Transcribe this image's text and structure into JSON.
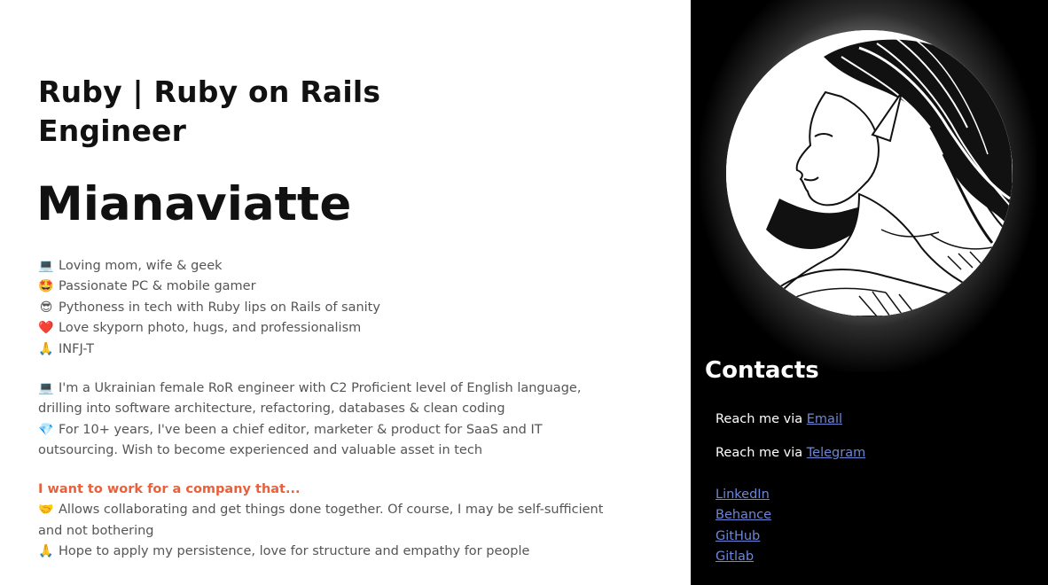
{
  "header": {
    "role": "Ruby | Ruby on Rails Engineer",
    "name": "Mianaviatte"
  },
  "bio": [
    {
      "icon": "laptop-icon",
      "glyph": "💻",
      "text": "Loving mom, wife & geek"
    },
    {
      "icon": "star-struck-icon",
      "glyph": "🤩",
      "text": "Passionate PC & mobile gamer"
    },
    {
      "icon": "sunglasses-icon",
      "glyph": "😎",
      "text": "Pythoness in tech with Ruby lips on Rails of sanity"
    },
    {
      "icon": "heart-icon",
      "glyph": "❤️",
      "text": "Love skyporn photo, hugs, and professionalism"
    },
    {
      "icon": "folded-hands-icon",
      "glyph": "🙏",
      "text": "INFJ-T"
    }
  ],
  "about": {
    "line1_glyph": "💻",
    "line1_text": "I'm a Ukrainian female RoR engineer with C2 Proficient level of English language, drilling into software architecture, refactoring, databases & clean coding",
    "line2_glyph": "💎",
    "line2_text": "For 10+ years, I've been a chief editor, marketer & product for SaaS and IT outsourcing. Wish to become experienced and valuable asset in tech"
  },
  "want": {
    "heading": "I want to work for a company that...",
    "line1_glyph": "🤝",
    "line1_text": "Allows collaborating and get things done together. Of course, I may be self-sufficient and not bothering",
    "line2_glyph": "🙏",
    "line2_text": "Hope to apply my persistence, love for structure and empathy for people"
  },
  "contacts": {
    "title": "Contacts",
    "reach_prefix": "Reach me via",
    "email_label": "Email",
    "telegram_label": "Telegram",
    "links": [
      "LinkedIn",
      "Behance",
      "GitHub",
      "Gitlab"
    ]
  },
  "colors": {
    "accent": "#e8613c",
    "link": "#6d87d6",
    "panel": "#000000",
    "text": "#555555"
  }
}
